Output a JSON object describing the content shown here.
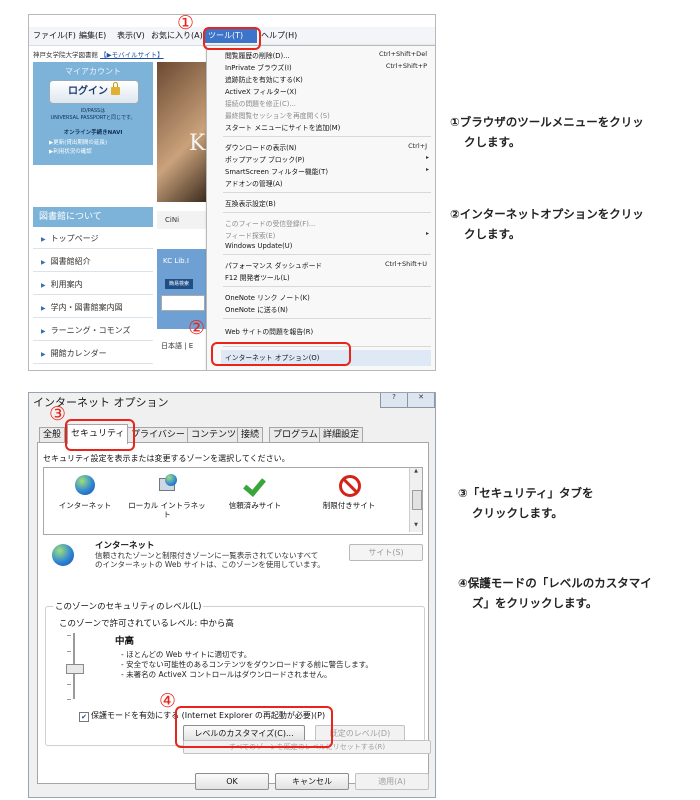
{
  "browser": {
    "menubar": [
      "ファイル(F)",
      "編集(E)",
      "表示(V)",
      "お気に入り(A)"
    ],
    "tools_menu": "ツール(T)",
    "help_menu": "ヘルプ(H)",
    "breadcrumb_text": "神戸女学院大学図書館",
    "breadcrumb_link": "【▶モバイルサイト】",
    "myaccount": "マイアカウント",
    "login": "ログイン",
    "login_note_1": "ID/PASSは",
    "login_note_2": "UNIVERSAL PASSPORTと同じです。",
    "navi_title": "オンライン手続きNAVI",
    "navi_links": [
      "▶更新(貸出期間の延長)",
      "▶利用状況の確認"
    ],
    "library_section": "図書館について",
    "sidebar_items": [
      "トップページ",
      "図書館紹介",
      "利用案内",
      "学内・図書館案内図",
      "ラーニング・コモンズ",
      "開館カレンダー"
    ],
    "hero_text": "KC",
    "cinii": "CiNi",
    "kclib": "KC Lib.I",
    "kclib_button": "簡易検索",
    "lang": "日本語 | E"
  },
  "tools_dropdown": {
    "items": [
      {
        "label": "閲覧履歴の削除(D)...",
        "shortcut": "Ctrl+Shift+Del",
        "disabled": false
      },
      {
        "label": "InPrivate ブラウズ(I)",
        "shortcut": "Ctrl+Shift+P",
        "disabled": false
      },
      {
        "label": "追跡防止を有効にする(K)",
        "shortcut": "",
        "disabled": false
      },
      {
        "label": "ActiveX フィルター(X)",
        "shortcut": "",
        "disabled": false
      },
      {
        "label": "接続の問題を修正(C)...",
        "shortcut": "",
        "disabled": true
      },
      {
        "label": "最終閲覧セッションを再度開く(S)",
        "shortcut": "",
        "disabled": true
      },
      {
        "label": "スタート メニューにサイトを追加(M)",
        "shortcut": "",
        "disabled": false
      },
      {
        "label": "ダウンロードの表示(N)",
        "shortcut": "Ctrl+J",
        "disabled": false
      },
      {
        "label": "ポップアップ ブロック(P)",
        "shortcut": "",
        "disabled": false,
        "submenu": true
      },
      {
        "label": "SmartScreen フィルター機能(T)",
        "shortcut": "",
        "disabled": false,
        "submenu": true
      },
      {
        "label": "アドオンの管理(A)",
        "shortcut": "",
        "disabled": false
      },
      {
        "label": "互換表示設定(B)",
        "shortcut": "",
        "disabled": false
      },
      {
        "label": "このフィードの受信登録(F)...",
        "shortcut": "",
        "disabled": true
      },
      {
        "label": "フィード探索(E)",
        "shortcut": "",
        "disabled": true,
        "submenu": true
      },
      {
        "label": "Windows Update(U)",
        "shortcut": "",
        "disabled": false
      },
      {
        "label": "パフォーマンス ダッシュボード",
        "shortcut": "Ctrl+Shift+U",
        "disabled": false
      },
      {
        "label": "F12 開発者ツール(L)",
        "shortcut": "",
        "disabled": false
      },
      {
        "label": "OneNote リンク ノート(K)",
        "shortcut": "",
        "disabled": false
      },
      {
        "label": "OneNote に送る(N)",
        "shortcut": "",
        "disabled": false
      },
      {
        "label": "Web サイトの問題を報告(R)",
        "shortcut": "",
        "disabled": false
      },
      {
        "label": "インターネット オプション(O)",
        "shortcut": "",
        "disabled": false
      }
    ]
  },
  "callouts": {
    "c1": "①",
    "c2": "②",
    "c3": "③",
    "c4": "④"
  },
  "instructions": {
    "step1_line1": "①ブラウザのツールメニューをクリッ",
    "step1_line2": "クします。",
    "step2_line1": "②インターネットオプションをクリッ",
    "step2_line2": "クします。",
    "step3_line1": "③「セキュリティ」タブを",
    "step3_line2": "クリックします。",
    "step4_line1": "④保護モードの「レベルのカスタマイ",
    "step4_line2": "ズ」をクリックします。"
  },
  "dialog": {
    "title": "インターネット オプション",
    "title_btn_help": "?",
    "title_btn_close": "✕",
    "tabs": [
      "全般",
      "セキュリティ",
      "プライバシー",
      "コンテンツ",
      "接続",
      "プログラム",
      "詳細設定"
    ],
    "zone_prompt": "セキュリティ設定を表示または変更するゾーンを選択してください。",
    "zones": [
      {
        "label": "インターネット",
        "icon": "globe-icon"
      },
      {
        "label": "ローカル イントラネット",
        "icon": "intranet-icon"
      },
      {
        "label": "信頼済みサイト",
        "icon": "check-icon"
      },
      {
        "label": "制限付きサイト",
        "icon": "restricted-icon"
      }
    ],
    "zone_name": "インターネット",
    "zone_desc": "信頼されたゾーンと制限付きゾーンに一覧表示されていないすべてのインターネットの Web サイトは、このゾーンを使用しています。",
    "site_button": "サイト(S)",
    "level_group_title": "このゾーンのセキュリティのレベル(L)",
    "allowed_level": "このゾーンで許可されているレベル: 中から高",
    "level_name": "中高",
    "level_desc": [
      "- ほとんどの Web サイトに適切です。",
      "- 安全でない可能性のあるコンテンツをダウンロードする前に警告します。",
      "- 未署名の ActiveX コントロールはダウンロードされません。"
    ],
    "protect_label": "保護モードを有効にする (Internet Explorer の再起動が必要)(P)",
    "protect_checked": true,
    "customize_button": "レベルのカスタマイズ(C)...",
    "default_button": "既定のレベル(D)",
    "reset_all_button": "すべてのゾーンを既定のレベルにリセットする(R)",
    "ok": "OK",
    "cancel": "キャンセル",
    "apply": "適用(A)"
  },
  "colors": {
    "callout_red": "#e8241b",
    "menu_highlight": "#3b74c8",
    "sidebar_blue": "#7db3d8"
  }
}
